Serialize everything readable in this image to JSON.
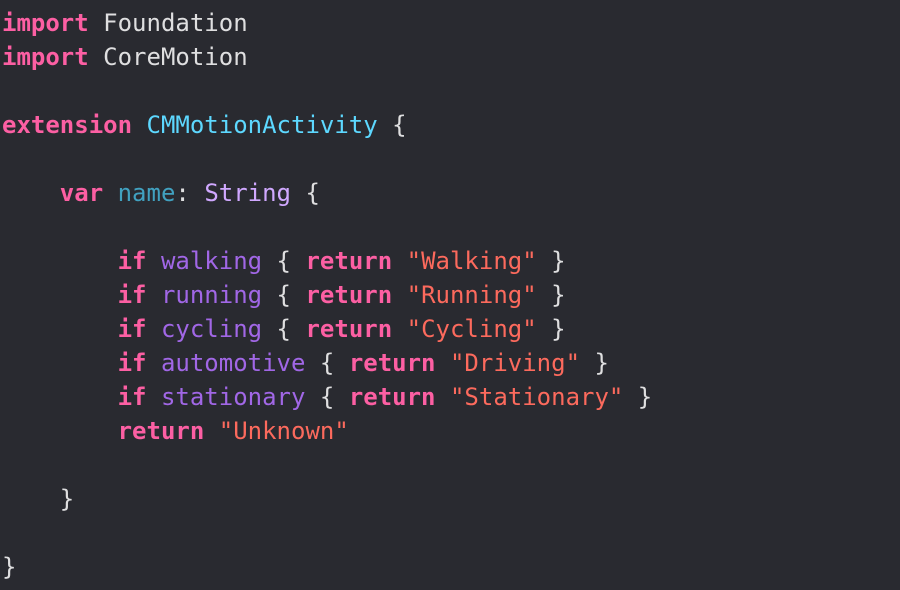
{
  "colors": {
    "background": "#292a30",
    "plain": "#dfdfe0",
    "keyword": "#fc5fa3",
    "type_decl": "#5dd8ff",
    "type_ref": "#d0a8ff",
    "property_decl": "#41a1c0",
    "property_ref": "#a167e6",
    "string": "#fc6a5d"
  },
  "code_lines": [
    [
      {
        "t": "import",
        "c": "keyword",
        "b": true
      },
      {
        "t": " Foundation",
        "c": "plain"
      }
    ],
    [
      {
        "t": "import",
        "c": "keyword",
        "b": true
      },
      {
        "t": " CoreMotion",
        "c": "plain"
      }
    ],
    [],
    [
      {
        "t": "extension",
        "c": "keyword",
        "b": true
      },
      {
        "t": " ",
        "c": "plain"
      },
      {
        "t": "CMMotionActivity",
        "c": "type_decl"
      },
      {
        "t": " {",
        "c": "plain"
      }
    ],
    [],
    [
      {
        "t": "    ",
        "c": "plain"
      },
      {
        "t": "var",
        "c": "keyword",
        "b": true
      },
      {
        "t": " ",
        "c": "plain"
      },
      {
        "t": "name",
        "c": "property_decl"
      },
      {
        "t": ": ",
        "c": "plain"
      },
      {
        "t": "String",
        "c": "type_ref"
      },
      {
        "t": " {",
        "c": "plain"
      }
    ],
    [],
    [
      {
        "t": "        ",
        "c": "plain"
      },
      {
        "t": "if",
        "c": "keyword",
        "b": true
      },
      {
        "t": " ",
        "c": "plain"
      },
      {
        "t": "walking",
        "c": "property_ref"
      },
      {
        "t": " { ",
        "c": "plain"
      },
      {
        "t": "return",
        "c": "keyword",
        "b": true
      },
      {
        "t": " ",
        "c": "plain"
      },
      {
        "t": "\"Walking\"",
        "c": "string"
      },
      {
        "t": " }",
        "c": "plain"
      }
    ],
    [
      {
        "t": "        ",
        "c": "plain"
      },
      {
        "t": "if",
        "c": "keyword",
        "b": true
      },
      {
        "t": " ",
        "c": "plain"
      },
      {
        "t": "running",
        "c": "property_ref"
      },
      {
        "t": " { ",
        "c": "plain"
      },
      {
        "t": "return",
        "c": "keyword",
        "b": true
      },
      {
        "t": " ",
        "c": "plain"
      },
      {
        "t": "\"Running\"",
        "c": "string"
      },
      {
        "t": " }",
        "c": "plain"
      }
    ],
    [
      {
        "t": "        ",
        "c": "plain"
      },
      {
        "t": "if",
        "c": "keyword",
        "b": true
      },
      {
        "t": " ",
        "c": "plain"
      },
      {
        "t": "cycling",
        "c": "property_ref"
      },
      {
        "t": " { ",
        "c": "plain"
      },
      {
        "t": "return",
        "c": "keyword",
        "b": true
      },
      {
        "t": " ",
        "c": "plain"
      },
      {
        "t": "\"Cycling\"",
        "c": "string"
      },
      {
        "t": " }",
        "c": "plain"
      }
    ],
    [
      {
        "t": "        ",
        "c": "plain"
      },
      {
        "t": "if",
        "c": "keyword",
        "b": true
      },
      {
        "t": " ",
        "c": "plain"
      },
      {
        "t": "automotive",
        "c": "property_ref"
      },
      {
        "t": " { ",
        "c": "plain"
      },
      {
        "t": "return",
        "c": "keyword",
        "b": true
      },
      {
        "t": " ",
        "c": "plain"
      },
      {
        "t": "\"Driving\"",
        "c": "string"
      },
      {
        "t": " }",
        "c": "plain"
      }
    ],
    [
      {
        "t": "        ",
        "c": "plain"
      },
      {
        "t": "if",
        "c": "keyword",
        "b": true
      },
      {
        "t": " ",
        "c": "plain"
      },
      {
        "t": "stationary",
        "c": "property_ref"
      },
      {
        "t": " { ",
        "c": "plain"
      },
      {
        "t": "return",
        "c": "keyword",
        "b": true
      },
      {
        "t": " ",
        "c": "plain"
      },
      {
        "t": "\"Stationary\"",
        "c": "string"
      },
      {
        "t": " }",
        "c": "plain"
      }
    ],
    [
      {
        "t": "        ",
        "c": "plain"
      },
      {
        "t": "return",
        "c": "keyword",
        "b": true
      },
      {
        "t": " ",
        "c": "plain"
      },
      {
        "t": "\"Unknown\"",
        "c": "string"
      }
    ],
    [],
    [
      {
        "t": "    }",
        "c": "plain"
      }
    ],
    [],
    [
      {
        "t": "}",
        "c": "plain"
      }
    ]
  ]
}
